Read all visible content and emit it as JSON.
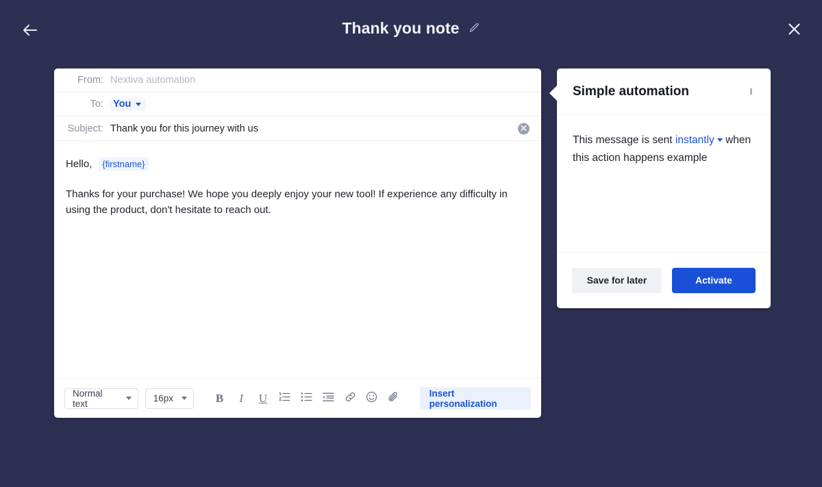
{
  "topbar": {
    "back_icon": "arrow-left-icon",
    "title": "Thank you note",
    "edit_icon": "pencil-icon",
    "close_icon": "close-icon"
  },
  "composer": {
    "from": {
      "label": "From:",
      "value": "Nextiva automation"
    },
    "to": {
      "label": "To:",
      "value": "You"
    },
    "subject": {
      "label": "Subject:",
      "value": "Thank you for this journey with us",
      "clear_icon": "clear-circle-icon"
    },
    "body": {
      "greeting": "Hello,",
      "token": "{firstname}",
      "paragraph": "Thanks for your purchase! We hope you deeply enjoy your new tool! If experience any difficulty in using the product, don't hesitate to reach out."
    },
    "toolbar": {
      "text_style": "Normal text",
      "font_size": "16px",
      "bold": "B",
      "italic": "I",
      "underline": "U",
      "ordered_list_icon": "ordered-list-icon",
      "bullet_list_icon": "bullet-list-icon",
      "indent_icon": "indent-icon",
      "link_icon": "link-icon",
      "emoji_icon": "emoji-icon",
      "attachment_icon": "paperclip-icon",
      "insert_personalization": "Insert personalization"
    }
  },
  "panel": {
    "title": "Simple automation",
    "menu_icon": "kebab-menu-icon",
    "sentence_part1": "This message is sent",
    "timing": "instantly",
    "sentence_part2": "when this action happens example",
    "save_label": "Save for later",
    "activate_label": "Activate"
  },
  "colors": {
    "background": "#2d3052",
    "accent_blue": "#1b52d4",
    "primary_button": "#1a50d8",
    "card": "#ffffff"
  }
}
